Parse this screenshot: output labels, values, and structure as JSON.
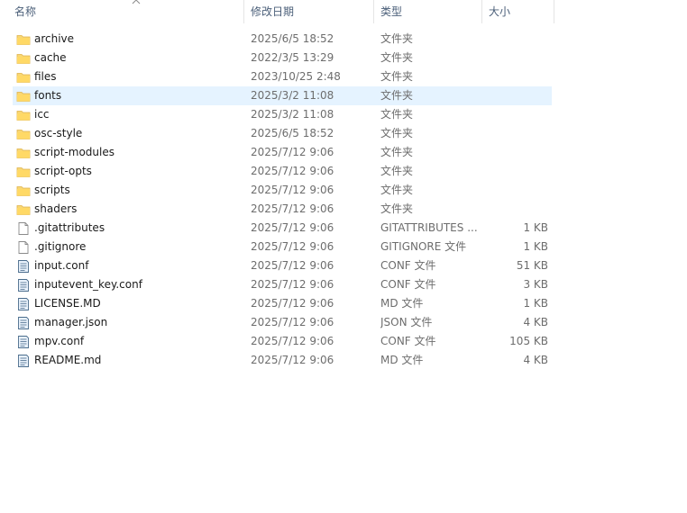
{
  "columns": {
    "name": "名称",
    "date": "修改日期",
    "type": "类型",
    "size": "大小"
  },
  "files": [
    {
      "name": "archive",
      "date": "2025/6/5 18:52",
      "type": "文件夹",
      "size": "",
      "icon": "folder-icon"
    },
    {
      "name": "cache",
      "date": "2022/3/5 13:29",
      "type": "文件夹",
      "size": "",
      "icon": "folder-icon"
    },
    {
      "name": "files",
      "date": "2023/10/25 2:48",
      "type": "文件夹",
      "size": "",
      "icon": "folder-icon"
    },
    {
      "name": "fonts",
      "date": "2025/3/2 11:08",
      "type": "文件夹",
      "size": "",
      "icon": "folder-icon",
      "selected": true
    },
    {
      "name": "icc",
      "date": "2025/3/2 11:08",
      "type": "文件夹",
      "size": "",
      "icon": "folder-icon"
    },
    {
      "name": "osc-style",
      "date": "2025/6/5 18:52",
      "type": "文件夹",
      "size": "",
      "icon": "folder-icon"
    },
    {
      "name": "script-modules",
      "date": "2025/7/12 9:06",
      "type": "文件夹",
      "size": "",
      "icon": "folder-icon"
    },
    {
      "name": "script-opts",
      "date": "2025/7/12 9:06",
      "type": "文件夹",
      "size": "",
      "icon": "folder-icon"
    },
    {
      "name": "scripts",
      "date": "2025/7/12 9:06",
      "type": "文件夹",
      "size": "",
      "icon": "folder-icon"
    },
    {
      "name": "shaders",
      "date": "2025/7/12 9:06",
      "type": "文件夹",
      "size": "",
      "icon": "folder-icon"
    },
    {
      "name": ".gitattributes",
      "date": "2025/7/12 9:06",
      "type": "GITATTRIBUTES ...",
      "size": "1 KB",
      "icon": "blank-file-icon"
    },
    {
      "name": ".gitignore",
      "date": "2025/7/12 9:06",
      "type": "GITIGNORE 文件",
      "size": "1 KB",
      "icon": "blank-file-icon"
    },
    {
      "name": "input.conf",
      "date": "2025/7/12 9:06",
      "type": "CONF 文件",
      "size": "51 KB",
      "icon": "text-file-icon"
    },
    {
      "name": "inputevent_key.conf",
      "date": "2025/7/12 9:06",
      "type": "CONF 文件",
      "size": "3 KB",
      "icon": "text-file-icon"
    },
    {
      "name": "LICENSE.MD",
      "date": "2025/7/12 9:06",
      "type": "MD 文件",
      "size": "1 KB",
      "icon": "text-file-icon"
    },
    {
      "name": "manager.json",
      "date": "2025/7/12 9:06",
      "type": "JSON 文件",
      "size": "4 KB",
      "icon": "text-file-icon"
    },
    {
      "name": "mpv.conf",
      "date": "2025/7/12 9:06",
      "type": "CONF 文件",
      "size": "105 KB",
      "icon": "text-file-icon"
    },
    {
      "name": "README.md",
      "date": "2025/7/12 9:06",
      "type": "MD 文件",
      "size": "4 KB",
      "icon": "text-file-icon"
    }
  ],
  "colors": {
    "header_text": "#4c607a",
    "selected_row": "#e5f3ff",
    "folder": "#f8d775"
  }
}
